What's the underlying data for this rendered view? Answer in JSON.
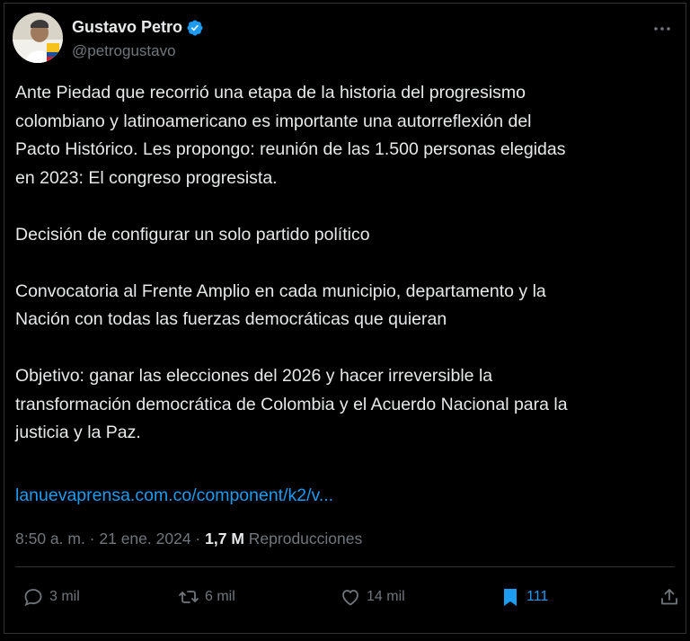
{
  "tweet": {
    "author": {
      "display_name": "Gustavo Petro",
      "handle": "@petrogustavo",
      "verified": true
    },
    "paragraphs": [
      "Ante Piedad que recorrió una etapa de la historia del progresismo\ncolombiano y latinoamericano es importante una autorreflexión del\nPacto Histórico. Les propongo: reunión de las 1.500 personas elegidas\nen 2023: El congreso progresista.",
      "Decisión de configurar un solo partido político",
      "Convocatoria al Frente Amplio en cada municipio, departamento y la\nNación con todas las fuerzas democráticas que quieran",
      "Objetivo: ganar las elecciones del 2026 y hacer irreversible la\ntransformación democrática de Colombia y el Acuerdo Nacional para la\njusticia y la Paz."
    ],
    "link_text": "lanuevaprensa.com.co/component/k2/v...",
    "timestamp": "8:50 a. m. · 21 ene. 2024 ·",
    "views_count": "1,7 M",
    "views_label": "Reproducciones",
    "actions": {
      "replies": "3 mil",
      "retweets": "6 mil",
      "likes": "14 mil",
      "bookmarks": "111"
    }
  },
  "colors": {
    "background": "#000000",
    "text": "#e7e9ea",
    "muted": "#71767b",
    "accent": "#1d9bf0",
    "border": "#2f3336"
  },
  "icons": {
    "verified": "verified-badge-icon",
    "more": "more-options-icon",
    "reply": "reply-icon",
    "retweet": "retweet-icon",
    "like": "like-icon",
    "bookmark": "bookmark-icon",
    "share": "share-icon"
  }
}
